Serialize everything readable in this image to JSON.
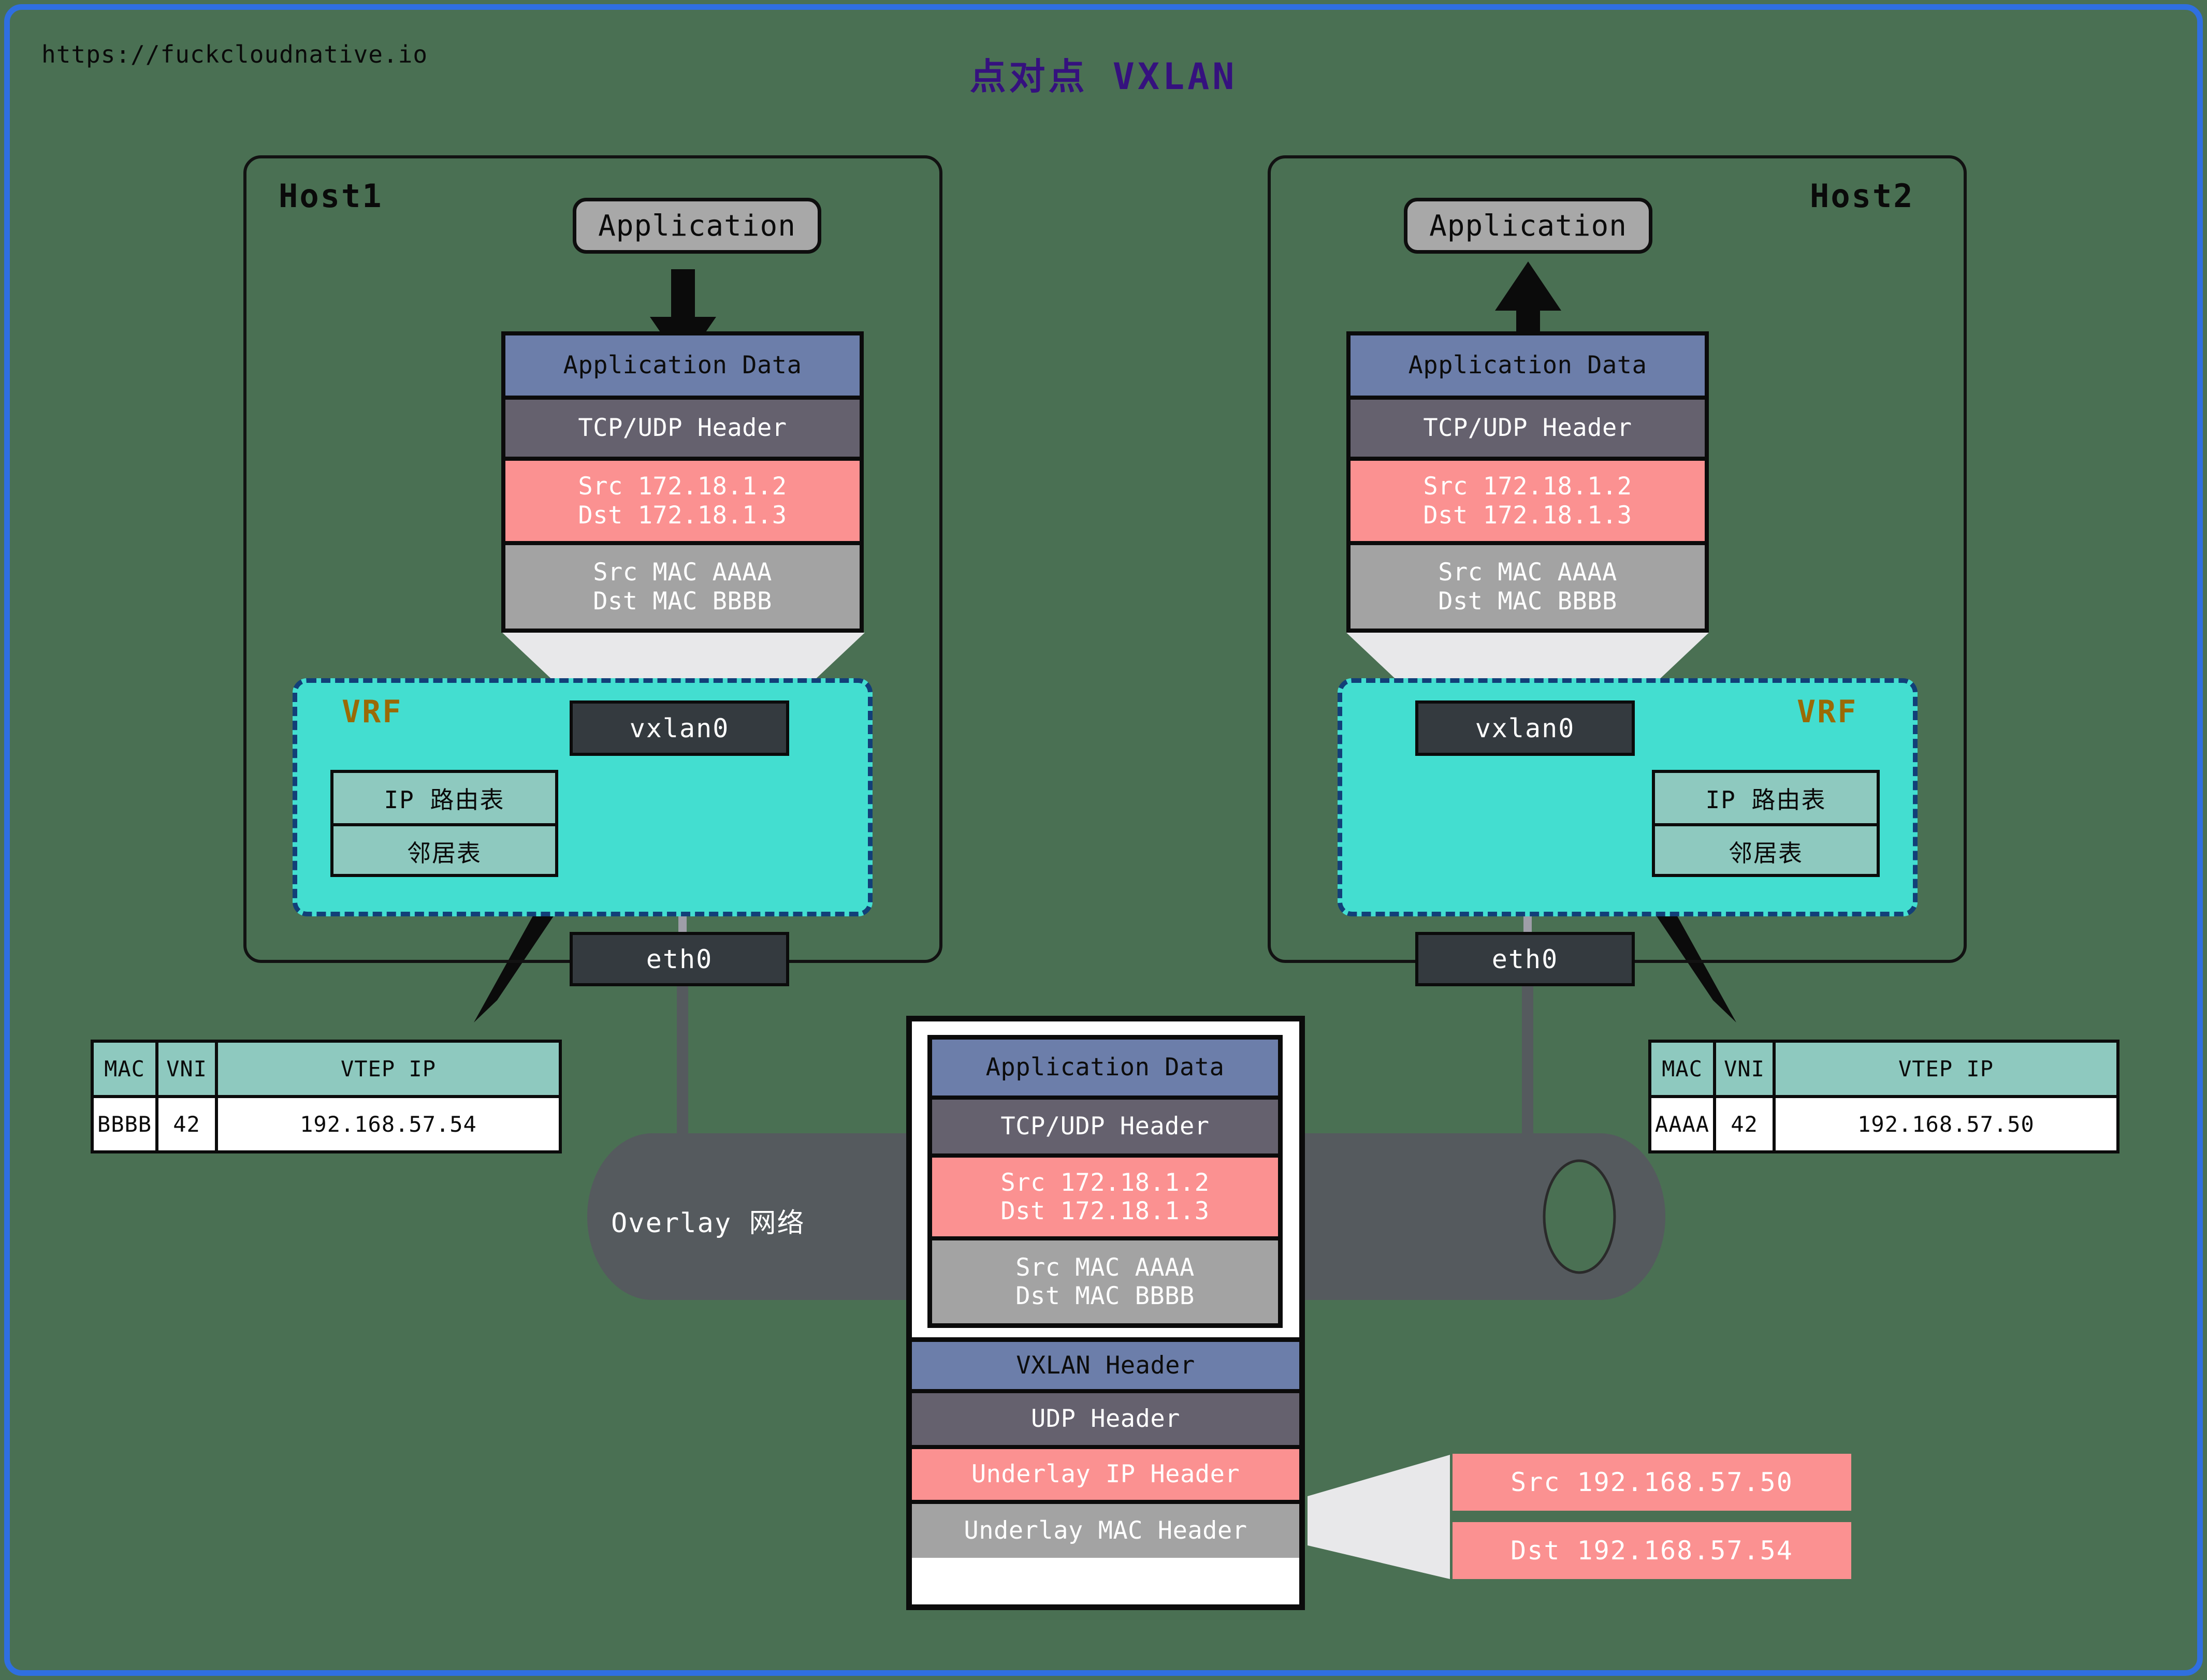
{
  "page": {
    "site_url": "https://fuckcloudnative.io",
    "title": "点对点 VXLAN",
    "bg_color": "#4a7053",
    "frame_color": "#2f6fe0",
    "title_color": "#35117e"
  },
  "hosts": [
    {
      "name": "Host1",
      "app_label": "Application",
      "vrf_label": "VRF",
      "vxlan_label": "vxlan0",
      "eth_label": "eth0",
      "vrf_tables": {
        "route": "IP 路由表",
        "neigh": "邻居表"
      },
      "packet": {
        "app_data": "Application Data",
        "tcp_udp": "TCP/UDP Header",
        "ip_src": "Src 172.18.1.2",
        "ip_dst": "Dst 172.18.1.3",
        "mac_src": "Src MAC AAAA",
        "mac_dst": "Dst MAC BBBB"
      }
    },
    {
      "name": "Host2",
      "app_label": "Application",
      "vrf_label": "VRF",
      "vxlan_label": "vxlan0",
      "eth_label": "eth0",
      "vrf_tables": {
        "route": "IP 路由表",
        "neigh": "邻居表"
      },
      "packet": {
        "app_data": "Application Data",
        "tcp_udp": "TCP/UDP Header",
        "ip_src": "Src 172.18.1.2",
        "ip_dst": "Dst 172.18.1.3",
        "mac_src": "Src MAC AAAA",
        "mac_dst": "Dst MAC BBBB"
      }
    }
  ],
  "fdb_tables": [
    {
      "headers": [
        "MAC",
        "VNI",
        "VTEP IP"
      ],
      "row": [
        "BBBB",
        "42",
        "192.168.57.54"
      ]
    },
    {
      "headers": [
        "MAC",
        "VNI",
        "VTEP IP"
      ],
      "row": [
        "AAAA",
        "42",
        "192.168.57.50"
      ]
    }
  ],
  "overlay": {
    "label": "Overlay 网络"
  },
  "encap_packet": {
    "inner": {
      "app_data": "Application Data",
      "tcp_udp": "TCP/UDP Header",
      "ip_src": "Src 172.18.1.2",
      "ip_dst": "Dst 172.18.1.3",
      "mac_src": "Src MAC AAAA",
      "mac_dst": "Dst MAC BBBB"
    },
    "outer": {
      "vxlan": "VXLAN Header",
      "udp": "UDP Header",
      "underlay_ip": "Underlay IP Header",
      "underlay_mac": "Underlay MAC Header"
    }
  },
  "underlay_callout": {
    "src": "Src 192.168.57.50",
    "dst": "Dst 192.168.57.54"
  },
  "colors": {
    "app_data": "#6c7eaa",
    "tcp_udp": "#65616e",
    "ip": "#fb9191",
    "mac": "#a3a3a3",
    "vrf": "#43ded0",
    "vrf_border": "#123f78",
    "device": "#343a3f",
    "table_header": "#8ec9bf"
  }
}
